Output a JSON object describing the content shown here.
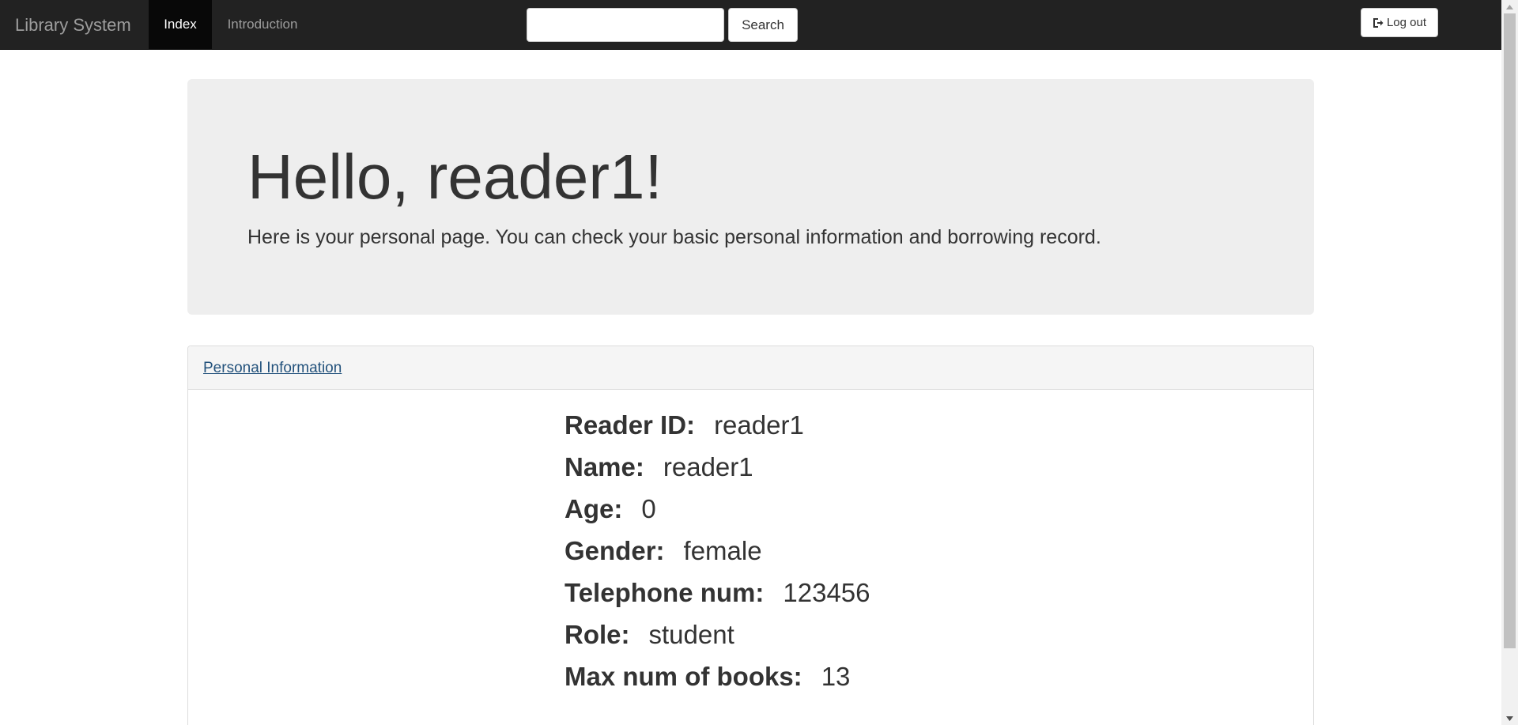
{
  "navbar": {
    "brand": "Library System",
    "items": [
      {
        "label": "Index",
        "active": true
      },
      {
        "label": "Introduction",
        "active": false
      }
    ],
    "search": {
      "placeholder": "",
      "value": "",
      "button_label": "Search"
    },
    "logout": {
      "label": "Log out",
      "icon": "log-out-icon"
    },
    "colors": {
      "background": "#222222",
      "active_background": "#080808",
      "text": "#9d9d9d",
      "active_text": "#ffffff"
    }
  },
  "jumbotron": {
    "title": "Hello, reader1!",
    "subtitle": "Here is your personal page. You can check your basic personal information and borrowing record."
  },
  "personal_info": {
    "heading": "Personal Information",
    "fields": [
      {
        "label": "Reader ID:",
        "value": "reader1"
      },
      {
        "label": "Name:",
        "value": "reader1"
      },
      {
        "label": "Age:",
        "value": "0"
      },
      {
        "label": "Gender:",
        "value": "female"
      },
      {
        "label": "Telephone num:",
        "value": "123456"
      },
      {
        "label": "Role:",
        "value": "student"
      },
      {
        "label": "Max num of books:",
        "value": "13"
      }
    ]
  }
}
